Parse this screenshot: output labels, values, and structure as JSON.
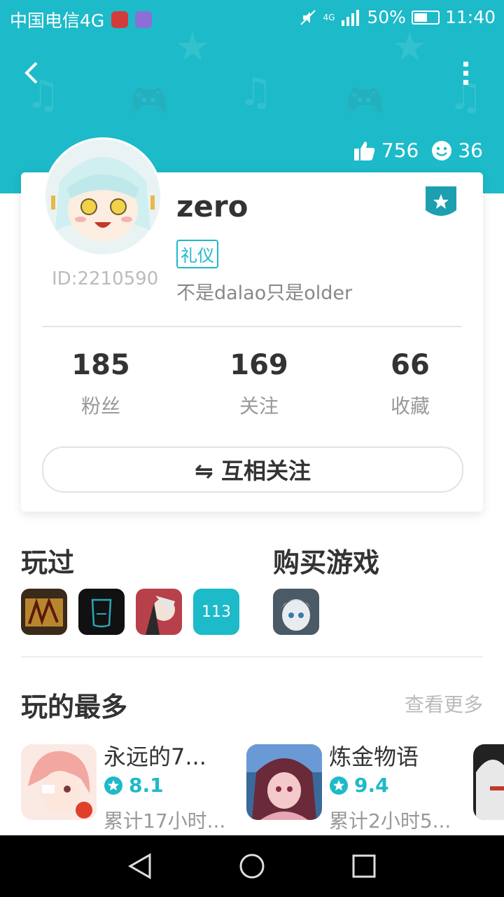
{
  "status_bar": {
    "carrier": "中国电信4G",
    "network": "4G",
    "battery": "50%",
    "time": "11:40"
  },
  "header": {
    "likes": "756",
    "smiles": "36"
  },
  "profile": {
    "name": "zero",
    "tag": "礼仪",
    "bio": "不是dalao只是older",
    "id": "ID:2210590",
    "stats": [
      {
        "value": "185",
        "label": "粉丝"
      },
      {
        "value": "169",
        "label": "关注"
      },
      {
        "value": "66",
        "label": "收藏"
      }
    ],
    "follow_button": "⇋ 互相关注"
  },
  "played": {
    "title": "玩过",
    "count": "113"
  },
  "purchased": {
    "title": "购买游戏"
  },
  "most_played": {
    "title": "玩的最多",
    "see_more": "查看更多",
    "games": [
      {
        "name": "永远的7...",
        "rating": "8.1",
        "time": "累计17小时..."
      },
      {
        "name": "炼金物语",
        "rating": "9.4",
        "time": "累计2小时5..."
      }
    ]
  },
  "colors": {
    "accent": "#1dbac9"
  }
}
